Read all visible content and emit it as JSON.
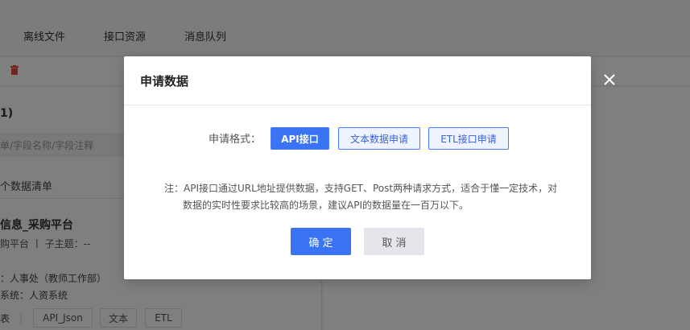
{
  "background": {
    "tabs": [
      "离线文件",
      "接口资源",
      "消息队列"
    ],
    "panel_count": "1)",
    "search_placeholder": "单/字段名称/字段注释",
    "list_count": "个数据清单",
    "item": {
      "title": "信息_采购平台",
      "subtitle": "购平台 丨 子主题：--",
      "department": "：人事处（教师工作部）",
      "system": "系统：人资系统",
      "row_label": "表",
      "tags": [
        "API_Json",
        "文本",
        "ETL"
      ]
    }
  },
  "modal": {
    "title": "申请数据",
    "format_label": "申请格式：",
    "options": [
      {
        "label": "API接口",
        "active": true
      },
      {
        "label": "文本数据申请",
        "active": false
      },
      {
        "label": "ETL接口申请",
        "active": false
      }
    ],
    "note_line1": "注：API接口通过URL地址提供数据，支持GET、Post两种请求方式，适合于懂一定技术，对",
    "note_line2": "数据的实时性要求比较高的场景，建议API的数据量在一百万以下。",
    "confirm_label": "确 定",
    "cancel_label": "取 消"
  },
  "colors": {
    "primary": "#3a74f5",
    "mask": "rgba(0,0,0,0.5)"
  },
  "icons": {
    "close": "close-icon",
    "trash": "trash-icon"
  }
}
